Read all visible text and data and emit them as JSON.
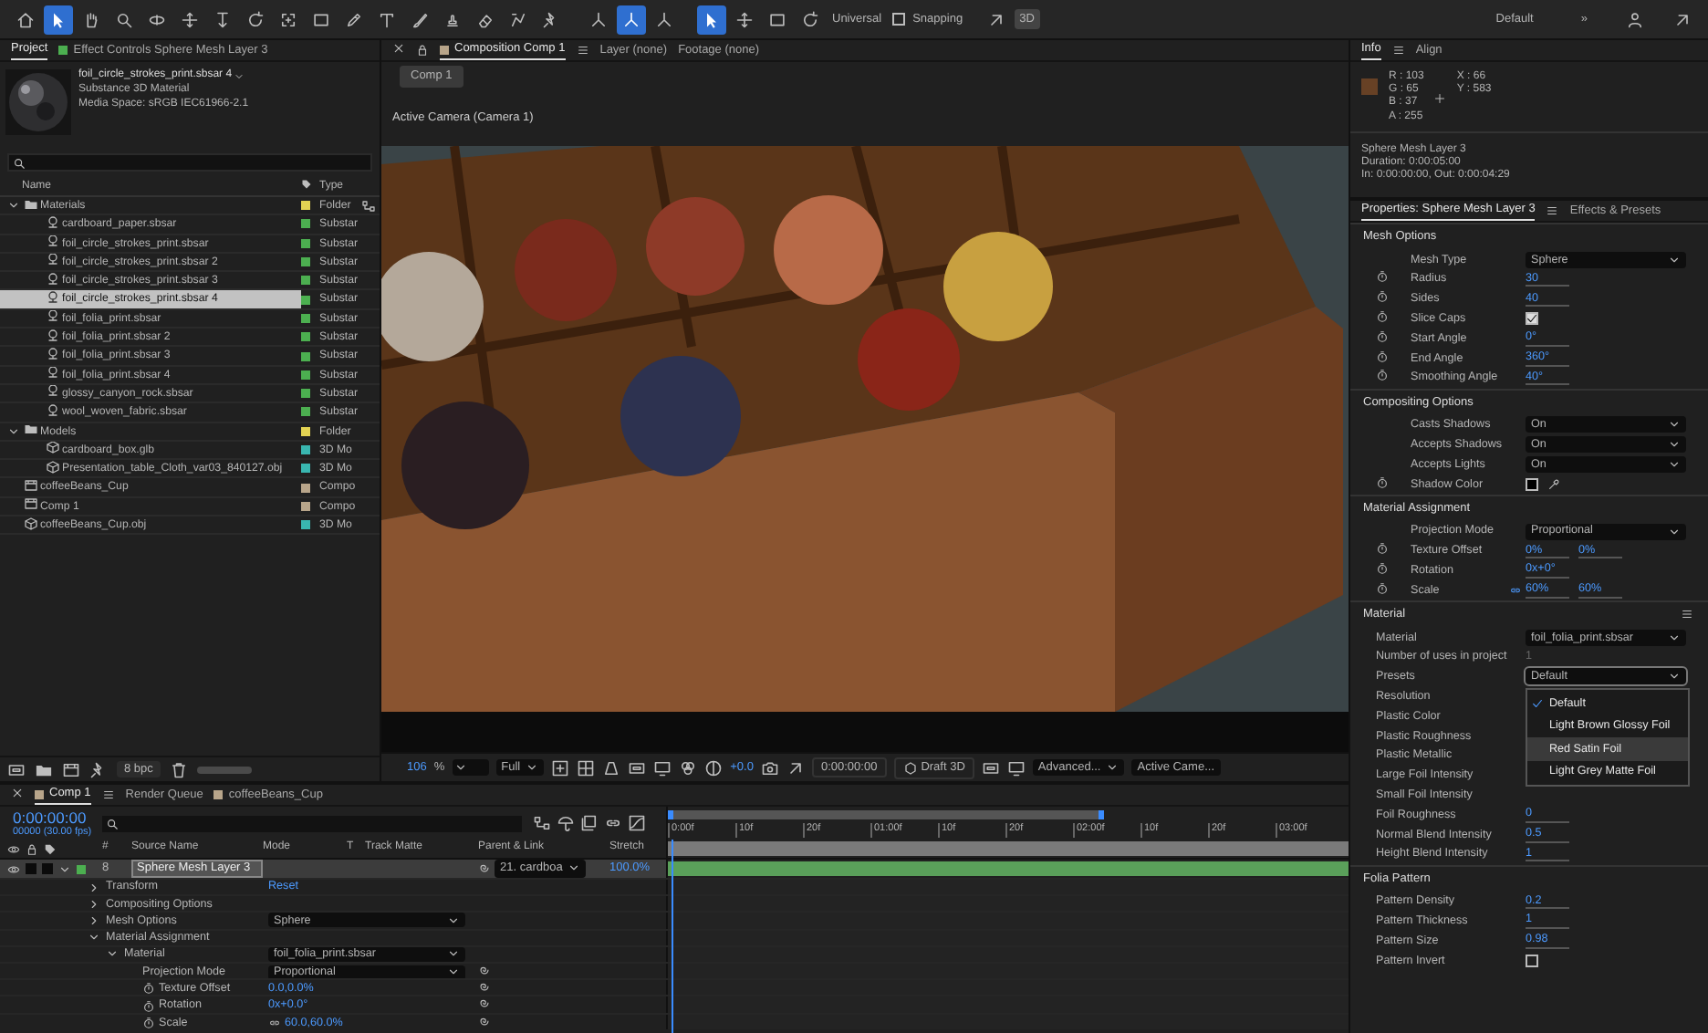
{
  "toolbar": {
    "tools": [
      {
        "kind": "home",
        "selected": false
      },
      {
        "kind": "select",
        "selected": true
      },
      {
        "kind": "hand",
        "selected": false
      },
      {
        "kind": "zoom",
        "selected": false
      },
      {
        "kind": "orbit",
        "selected": false
      },
      {
        "kind": "move",
        "selected": false
      },
      {
        "kind": "dolly",
        "selected": false
      },
      {
        "kind": "rotate",
        "selected": false
      },
      {
        "kind": "anchor",
        "selected": false
      },
      {
        "kind": "rect",
        "selected": false
      },
      {
        "kind": "pen",
        "selected": false
      },
      {
        "kind": "type",
        "selected": false
      },
      {
        "kind": "brush",
        "selected": false
      },
      {
        "kind": "stamp",
        "selected": false
      },
      {
        "kind": "eraser",
        "selected": false
      },
      {
        "kind": "roto",
        "selected": false
      },
      {
        "kind": "pin",
        "selected": false
      }
    ],
    "axis_modes": [
      {
        "kind": "axes",
        "selected": false
      },
      {
        "kind": "axes",
        "selected": true
      },
      {
        "kind": "axes",
        "selected": false
      }
    ],
    "gizmo_tools": [
      {
        "kind": "select",
        "selected": true
      },
      {
        "kind": "move",
        "selected": false
      },
      {
        "kind": "rect",
        "selected": false
      },
      {
        "kind": "rotate",
        "selected": false
      }
    ],
    "gizmo_label": "Universal",
    "snapping": {
      "label": "Snapping",
      "checked": false
    },
    "mode_3d": "3D",
    "workspace": "Default",
    "more": "»"
  },
  "project": {
    "tabs": [
      {
        "label": "Project",
        "selected": true
      },
      {
        "label": "Effect Controls Sphere Mesh Layer 3",
        "selected": false,
        "color": "#4caf50"
      }
    ],
    "asset": {
      "name": "foil_circle_strokes_print.sbsar 4",
      "lines": [
        "Substance 3D Material",
        "Media Space: sRGB IEC61966-2.1"
      ]
    },
    "columns": [
      "Name",
      "Type"
    ],
    "items": [
      {
        "kind": "folder",
        "name": "Materials",
        "type": "Folder",
        "color": "#e3d353",
        "expanded": true,
        "selected": false,
        "children": [
          {
            "kind": "substance",
            "name": "cardboard_paper.sbsar",
            "type": "Substar",
            "color": "#4caf50",
            "selected": false
          },
          {
            "kind": "substance",
            "name": "foil_circle_strokes_print.sbsar",
            "type": "Substar",
            "color": "#4caf50",
            "selected": false
          },
          {
            "kind": "substance",
            "name": "foil_circle_strokes_print.sbsar 2",
            "type": "Substar",
            "color": "#4caf50",
            "selected": false
          },
          {
            "kind": "substance",
            "name": "foil_circle_strokes_print.sbsar 3",
            "type": "Substar",
            "color": "#4caf50",
            "selected": false
          },
          {
            "kind": "substance",
            "name": "foil_circle_strokes_print.sbsar 4",
            "type": "Substar",
            "color": "#4caf50",
            "selected": true
          },
          {
            "kind": "substance",
            "name": "foil_folia_print.sbsar",
            "type": "Substar",
            "color": "#4caf50",
            "selected": false
          },
          {
            "kind": "substance",
            "name": "foil_folia_print.sbsar 2",
            "type": "Substar",
            "color": "#4caf50",
            "selected": false
          },
          {
            "kind": "substance",
            "name": "foil_folia_print.sbsar 3",
            "type": "Substar",
            "color": "#4caf50",
            "selected": false
          },
          {
            "kind": "substance",
            "name": "foil_folia_print.sbsar 4",
            "type": "Substar",
            "color": "#4caf50",
            "selected": false
          },
          {
            "kind": "substance",
            "name": "glossy_canyon_rock.sbsar",
            "type": "Substar",
            "color": "#4caf50",
            "selected": false
          },
          {
            "kind": "substance",
            "name": "wool_woven_fabric.sbsar",
            "type": "Substar",
            "color": "#4caf50",
            "selected": false
          }
        ]
      },
      {
        "kind": "folder",
        "name": "Models",
        "type": "Folder",
        "color": "#e3d353",
        "expanded": true,
        "selected": false,
        "children": [
          {
            "kind": "model",
            "name": "cardboard_box.glb",
            "type": "3D Mo",
            "color": "#39b6b0",
            "selected": false
          },
          {
            "kind": "model",
            "name": "Presentation_table_Cloth_var03_840127.obj",
            "type": "3D Mo",
            "color": "#39b6b0",
            "selected": false
          }
        ]
      },
      {
        "kind": "comp",
        "name": "coffeeBeans_Cup",
        "type": "Compo",
        "color": "#b8a58a",
        "selected": false
      },
      {
        "kind": "comp",
        "name": "Comp 1",
        "type": "Compo",
        "color": "#b8a58a",
        "selected": false
      },
      {
        "kind": "model",
        "name": "coffeeBeans_Cup.obj",
        "type": "3D Mo",
        "color": "#39b6b0",
        "selected": false
      }
    ],
    "bpc": "8 bpc"
  },
  "viewer": {
    "tabs": [
      {
        "label": "Composition Comp 1",
        "selected": true,
        "color": "#b8a58a"
      },
      {
        "label": "Layer (none)",
        "selected": false
      },
      {
        "label": "Footage (none)",
        "selected": false
      }
    ],
    "breadcrumb": "Comp 1",
    "camera_label": "Active Camera (Camera 1)",
    "footer": {
      "zoom": "106",
      "zoom_unit": "%",
      "resolution": "Full",
      "exposure": "+0.0",
      "timecode": "0:00:00:00",
      "renderer": "Draft 3D",
      "view_options": "Advanced...",
      "camera": "Active Came..."
    }
  },
  "info": {
    "tabs": [
      {
        "label": "Info",
        "selected": true
      },
      {
        "label": "Align",
        "selected": false
      }
    ],
    "swatch": {
      "color": "#674125"
    },
    "channels": [
      "R : 103",
      "G : 65",
      "B : 37",
      "A : 255"
    ],
    "coords": [
      "X : 66",
      "Y : 583"
    ],
    "lines": [
      "Sphere Mesh Layer 3",
      "Duration: 0:00:05:00",
      "In: 0:00:00:00, Out: 0:00:04:29"
    ]
  },
  "properties": {
    "tabs": [
      {
        "label": "Properties: Sphere Mesh Layer 3",
        "selected": true
      },
      {
        "label": "Effects & Presets",
        "selected": false
      }
    ],
    "sections": [
      {
        "title": "Mesh Options",
        "stopwatch_column": true,
        "menu": false,
        "rows": [
          {
            "kind": "dropdown",
            "label": "Mesh Type",
            "value": "Sphere",
            "open": false,
            "stopwatch": false
          },
          {
            "kind": "number",
            "label": "Radius",
            "value": "30",
            "stopwatch": true
          },
          {
            "kind": "number",
            "label": "Sides",
            "value": "40",
            "stopwatch": true
          },
          {
            "kind": "check",
            "label": "Slice Caps",
            "checked": true,
            "stopwatch": true
          },
          {
            "kind": "number",
            "label": "Start Angle",
            "value": "0°",
            "stopwatch": true
          },
          {
            "kind": "number",
            "label": "End Angle",
            "value": "360°",
            "stopwatch": true
          },
          {
            "kind": "number",
            "label": "Smoothing Angle",
            "value": "40°",
            "stopwatch": true
          }
        ]
      },
      {
        "title": "Compositing Options",
        "stopwatch_column": true,
        "menu": false,
        "rows": [
          {
            "kind": "dropdown",
            "label": "Casts Shadows",
            "value": "On",
            "open": false,
            "stopwatch": false
          },
          {
            "kind": "dropdown",
            "label": "Accepts Shadows",
            "value": "On",
            "open": false,
            "stopwatch": false
          },
          {
            "kind": "dropdown",
            "label": "Accepts Lights",
            "value": "On",
            "open": false,
            "stopwatch": false
          },
          {
            "kind": "color",
            "label": "Shadow Color",
            "color": "#000000",
            "stopwatch": true
          }
        ]
      },
      {
        "title": "Material Assignment",
        "stopwatch_column": true,
        "menu": false,
        "rows": [
          {
            "kind": "dropdown",
            "label": "Projection Mode",
            "value": "Proportional",
            "open": false,
            "stopwatch": false
          },
          {
            "kind": "pair",
            "label": "Texture Offset",
            "values": [
              "0%",
              "0%"
            ],
            "linked": false,
            "stopwatch": true
          },
          {
            "kind": "number",
            "label": "Rotation",
            "value": "0x+0°",
            "stopwatch": true
          },
          {
            "kind": "pair",
            "label": "Scale",
            "values": [
              "60%",
              "60%"
            ],
            "linked": true,
            "stopwatch": true
          }
        ]
      },
      {
        "title": "Material",
        "stopwatch_column": false,
        "menu": true,
        "rows": [
          {
            "kind": "dropdown",
            "label": "Material",
            "value": "foil_folia_print.sbsar",
            "open": false
          },
          {
            "kind": "plain",
            "label": "Number of uses in project",
            "value": "1"
          },
          {
            "kind": "dropdown",
            "label": "Presets",
            "value": "Default",
            "open": true,
            "menu": [
              {
                "label": "Default",
                "checked": true,
                "highlighted": false
              },
              {
                "label": "Light Brown Glossy Foil",
                "checked": false,
                "highlighted": false
              },
              {
                "label": "Red Satin Foil",
                "checked": false,
                "highlighted": true
              },
              {
                "label": "Light Grey Matte Foil",
                "checked": false,
                "highlighted": false
              }
            ]
          },
          {
            "kind": "empty",
            "label": "Resolution"
          },
          {
            "kind": "empty",
            "label": "Plastic Color"
          },
          {
            "kind": "empty",
            "label": "Plastic Roughness"
          },
          {
            "kind": "empty",
            "label": "Plastic Metallic"
          },
          {
            "kind": "empty",
            "label": "Large Foil Intensity"
          },
          {
            "kind": "empty",
            "label": "Small Foil Intensity"
          },
          {
            "kind": "number",
            "label": "Foil Roughness",
            "value": "0"
          },
          {
            "kind": "number",
            "label": "Normal Blend Intensity",
            "value": "0.5"
          },
          {
            "kind": "number",
            "label": "Height Blend Intensity",
            "value": "1"
          }
        ]
      },
      {
        "title": "Folia Pattern",
        "stopwatch_column": false,
        "menu": false,
        "rows": [
          {
            "kind": "number",
            "label": "Pattern Density",
            "value": "0.2"
          },
          {
            "kind": "number",
            "label": "Pattern Thickness",
            "value": "1"
          },
          {
            "kind": "number",
            "label": "Pattern Size",
            "value": "0.98"
          },
          {
            "kind": "check",
            "label": "Pattern Invert",
            "checked": false
          }
        ]
      }
    ]
  },
  "timeline": {
    "tabs": [
      {
        "label": "Comp 1",
        "selected": true,
        "color": "#b8a58a"
      },
      {
        "label": "Render Queue",
        "selected": false
      },
      {
        "label": "coffeeBeans_Cup",
        "selected": false,
        "color": "#b8a58a"
      }
    ],
    "timecode": "0:00:00:00",
    "frame": "00000 (30.00 fps)",
    "columns": [
      "#",
      "Source Name",
      "Mode",
      "T",
      "Track Matte",
      "Parent & Link",
      "Stretch"
    ],
    "layer": {
      "number": "8",
      "name": "Sphere Mesh Layer 3",
      "color": "#4caf50",
      "parent": "21. cardboa",
      "stretch": "100.0%",
      "selected": true
    },
    "properties": [
      {
        "label": "Transform",
        "expanded": false,
        "kind": "link",
        "value": "Reset"
      },
      {
        "label": "Compositing Options",
        "expanded": false,
        "kind": "none"
      },
      {
        "label": "Mesh Options",
        "expanded": false,
        "kind": "dropdown",
        "value": "Sphere"
      },
      {
        "label": "Material Assignment",
        "expanded": true,
        "kind": "none",
        "children": [
          {
            "label": "Material",
            "expanded": true,
            "kind": "dropdown",
            "value": "foil_folia_print.sbsar",
            "children": [
              {
                "label": "Projection Mode",
                "kind": "dropdown",
                "value": "Proportional",
                "stopwatch": false
              },
              {
                "label": "Texture Offset",
                "kind": "number",
                "value": "0.0,0.0%",
                "stopwatch": true
              },
              {
                "label": "Rotation",
                "kind": "number",
                "value": "0x+0.0°",
                "stopwatch": true
              },
              {
                "label": "Scale",
                "kind": "number",
                "value": "60.0,60.0%",
                "stopwatch": true,
                "linked": true
              }
            ]
          }
        ]
      }
    ],
    "ruler": [
      "0:00f",
      "10f",
      "20f",
      "01:00f",
      "10f",
      "20f",
      "02:00f",
      "10f",
      "20f",
      "03:00f"
    ]
  }
}
